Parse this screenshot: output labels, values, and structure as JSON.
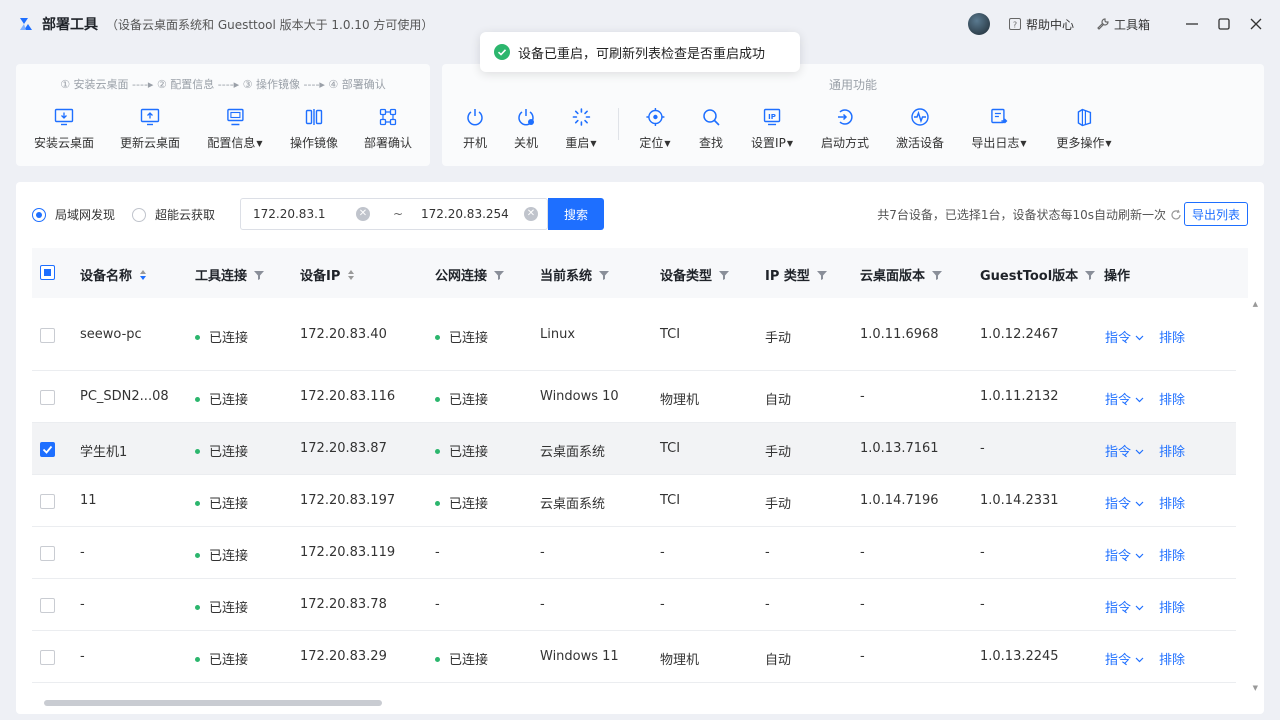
{
  "app": {
    "title": "部署工具",
    "subtitle": "（设备云桌面系统和 Guesttool 版本大于 1.0.10 方可使用）",
    "help_label": "帮助中心",
    "toolbox_label": "工具箱",
    "accent_color": "#1e6fff"
  },
  "toast": {
    "message": "设备已重启，可刷新列表检查是否重启成功",
    "icon": "check-circle-icon",
    "color": "#2cb66d"
  },
  "deploy_panel": {
    "steps_text": "① 安装云桌面 ‑‑‑‑▸ ② 配置信息 ‑‑‑‑▸ ③ 操作镜像 ‑‑‑‑▸ ④ 部署确认",
    "tools": [
      {
        "label": "安装云桌面",
        "icon": "install-desktop-icon"
      },
      {
        "label": "更新云桌面",
        "icon": "update-desktop-icon"
      },
      {
        "label": "配置信息",
        "icon": "config-icon",
        "dropdown": true
      },
      {
        "label": "操作镜像",
        "icon": "image-icon"
      },
      {
        "label": "部署确认",
        "icon": "deploy-confirm-icon"
      }
    ]
  },
  "common_panel": {
    "title": "通用功能",
    "tools": [
      {
        "label": "开机",
        "icon": "power-on-icon"
      },
      {
        "label": "关机",
        "icon": "power-off-icon"
      },
      {
        "label": "重启",
        "icon": "restart-icon",
        "dropdown": true
      },
      {
        "label": "定位",
        "icon": "locate-icon",
        "dropdown": true
      },
      {
        "label": "查找",
        "icon": "search-icon"
      },
      {
        "label": "设置IP",
        "icon": "set-ip-icon",
        "dropdown": true
      },
      {
        "label": "启动方式",
        "icon": "boot-mode-icon"
      },
      {
        "label": "激活设备",
        "icon": "activate-icon"
      },
      {
        "label": "导出日志",
        "icon": "export-log-icon",
        "dropdown": true
      },
      {
        "label": "更多操作",
        "icon": "more-icon",
        "dropdown": true
      }
    ]
  },
  "filters": {
    "lan_label": "局域网发现",
    "cloud_label": "超能云获取",
    "selected": "局域网发现",
    "ip_start": "172.20.83.1",
    "ip_end": "172.20.83.254",
    "separator": "~",
    "search_label": "搜索",
    "summary": "共7台设备，已选择1台，设备状态每10s自动刷新一次",
    "export_label": "导出列表"
  },
  "table": {
    "columns": [
      "设备名称",
      "工具连接",
      "设备IP",
      "公网连接",
      "当前系统",
      "设备类型",
      "IP 类型",
      "云桌面版本",
      "GuestTool版本",
      "操作"
    ],
    "action_cmd": "指令",
    "action_remove": "排除",
    "rows": [
      {
        "checked": false,
        "name": "seewo-pc",
        "tool": "已连接",
        "ip": "172.20.83.40",
        "net": "已连接",
        "os": "Linux",
        "type": "TCI",
        "iptype": "手动",
        "cloud": "1.0.11.6968",
        "guest": "1.0.12.2467"
      },
      {
        "checked": false,
        "name": "PC_SDN2...08",
        "tool": "已连接",
        "ip": "172.20.83.116",
        "net": "已连接",
        "os": "Windows 10",
        "type": "物理机",
        "iptype": "自动",
        "cloud": "-",
        "guest": "1.0.11.2132"
      },
      {
        "checked": true,
        "name": "学生机1",
        "tool": "已连接",
        "ip": "172.20.83.87",
        "net": "已连接",
        "os": "云桌面系统",
        "type": "TCI",
        "iptype": "手动",
        "cloud": "1.0.13.7161",
        "guest": "-"
      },
      {
        "checked": false,
        "name": "11",
        "tool": "已连接",
        "ip": "172.20.83.197",
        "net": "已连接",
        "os": "云桌面系统",
        "type": "TCI",
        "iptype": "手动",
        "cloud": "1.0.14.7196",
        "guest": "1.0.14.2331"
      },
      {
        "checked": false,
        "name": "-",
        "tool": "已连接",
        "ip": "172.20.83.119",
        "net": "-",
        "os": "-",
        "type": "-",
        "iptype": "-",
        "cloud": "-",
        "guest": "-"
      },
      {
        "checked": false,
        "name": "-",
        "tool": "已连接",
        "ip": "172.20.83.78",
        "net": "-",
        "os": "-",
        "type": "-",
        "iptype": "-",
        "cloud": "-",
        "guest": "-"
      },
      {
        "checked": false,
        "name": "-",
        "tool": "已连接",
        "ip": "172.20.83.29",
        "net": "已连接",
        "os": "Windows 11",
        "type": "物理机",
        "iptype": "自动",
        "cloud": "-",
        "guest": "1.0.13.2245"
      }
    ]
  }
}
